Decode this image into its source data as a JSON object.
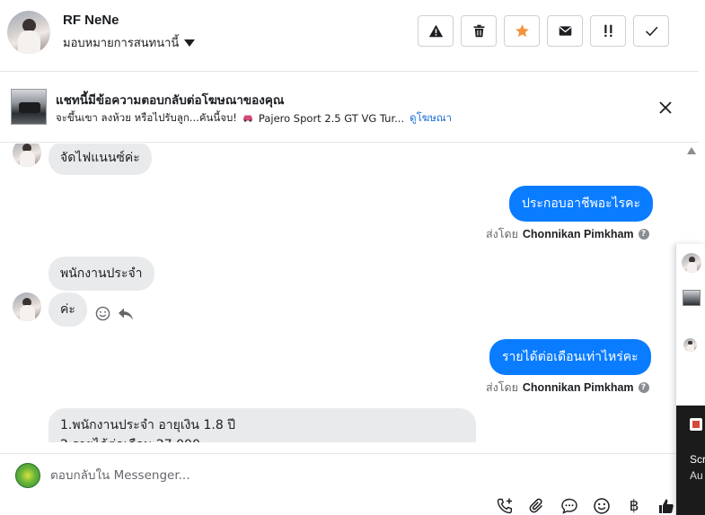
{
  "header": {
    "name": "RF NeNe",
    "assign_label": "มอบหมายการสนทนานี้",
    "buttons": [
      "spam-warning",
      "delete",
      "star",
      "mark-unread",
      "follow-up",
      "done"
    ]
  },
  "ad_banner": {
    "title": "แชทนี้มีข้อความตอบกลับต่อโฆษณาของคุณ",
    "ad_text": "จะขึ้นเขา ลงห้วย หรือไปรับลูก...คันนี้จบ!",
    "car_text": "Pajero Sport 2.5 GT VG Tur...",
    "view_ad_link": "ดูโฆษณา"
  },
  "messages": {
    "m1": "จัดไฟแนนซ์ค่ะ",
    "m2": "ประกอบอาชีพอะไรคะ",
    "m3": "พนักงานประจำ",
    "m4": "ค่ะ",
    "m5": "รายได้ต่อเดือนเท่าไหร่คะ",
    "m6_line1": "1.พนักงานประจำ อายุเงิน 1.8 ปี",
    "m6_line2": "2.รายได้ต่อเดือน 27,000"
  },
  "sent_by": {
    "prefix": "ส่งโดย",
    "agent": "Chonnikan Pimkham",
    "info": "?"
  },
  "composer": {
    "placeholder": "ตอบกลับใน Messenger...",
    "baht_symbol": "฿"
  },
  "side_panel": {
    "text1": "Scr",
    "text2": "Au"
  },
  "colors": {
    "outgoing_bubble": "#0a7cff",
    "incoming_bubble": "#e9eaec",
    "star": "#f5923e",
    "link": "#1a6ed8"
  }
}
